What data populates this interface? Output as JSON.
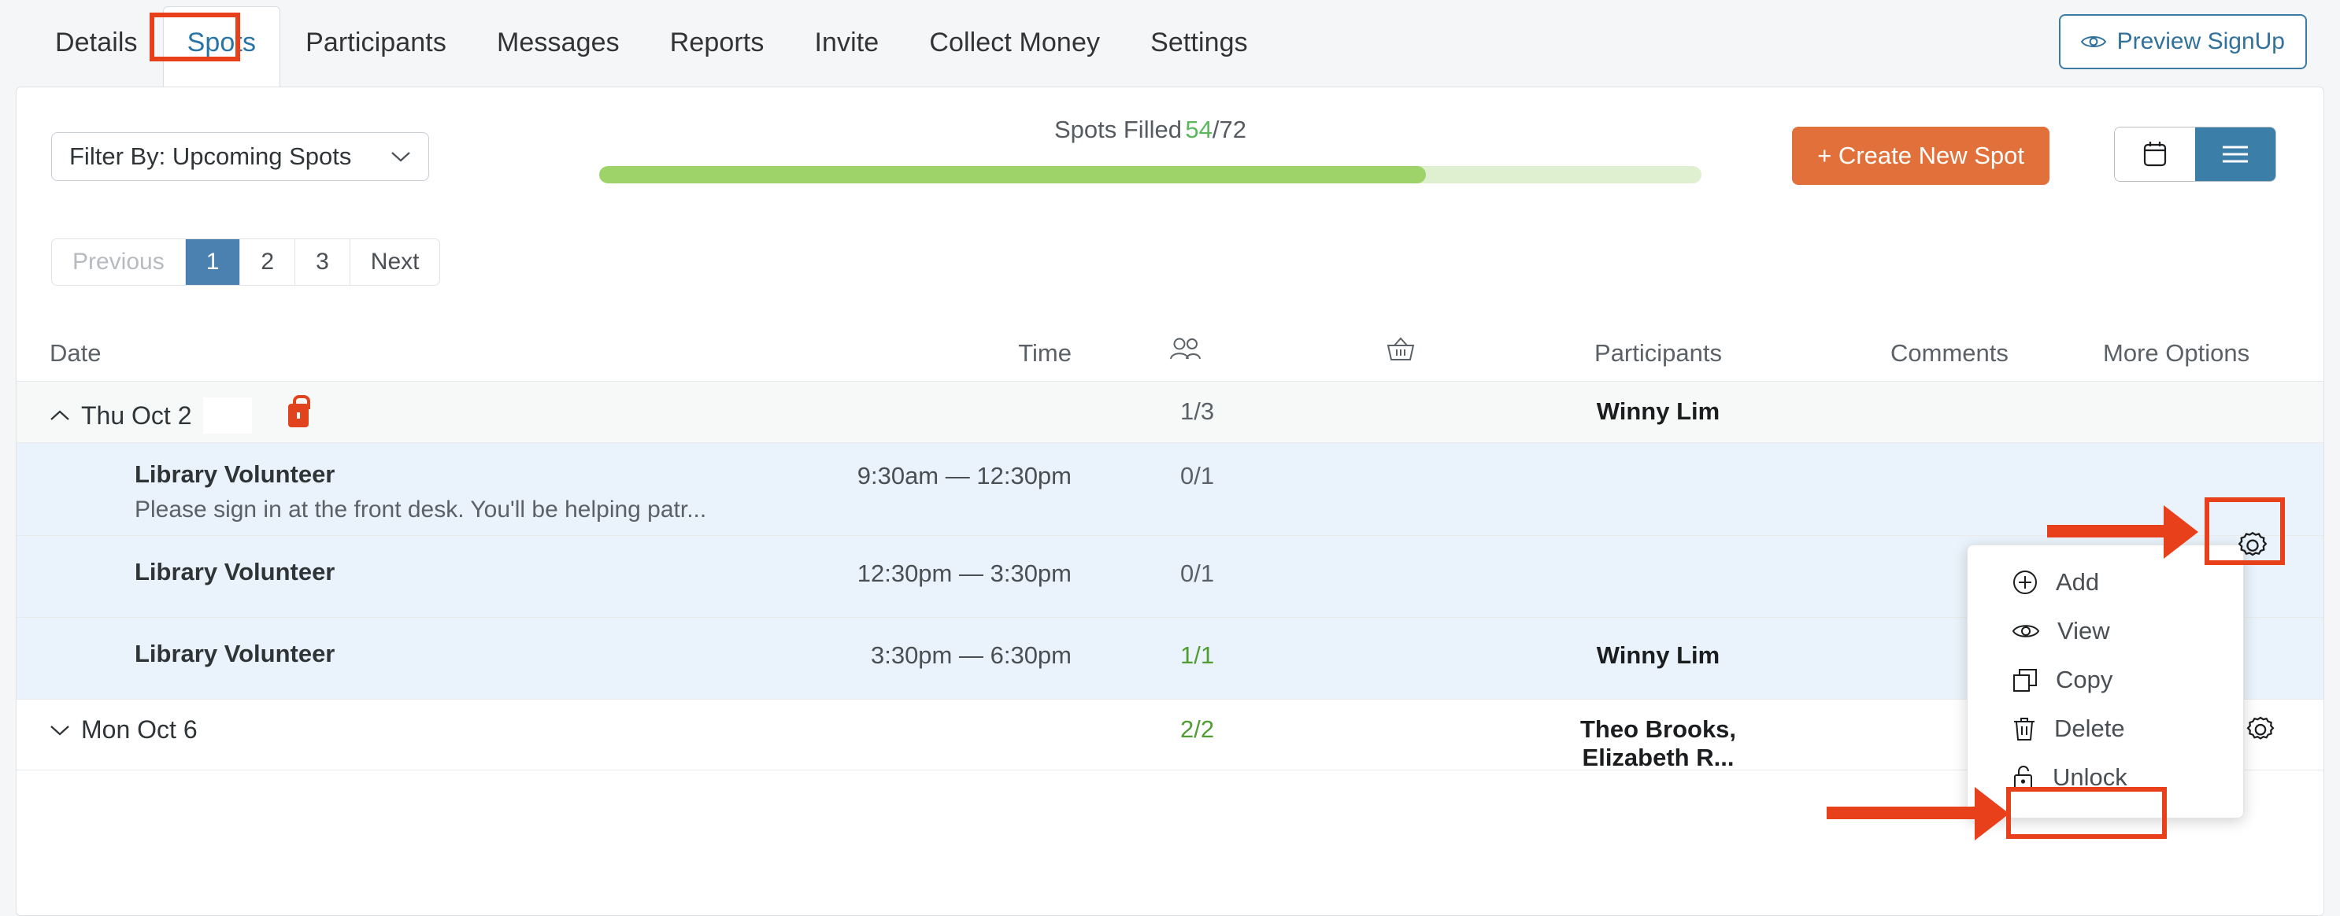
{
  "tabs": [
    {
      "label": "Details",
      "active": false
    },
    {
      "label": "Spots",
      "active": true
    },
    {
      "label": "Participants",
      "active": false
    },
    {
      "label": "Messages",
      "active": false
    },
    {
      "label": "Reports",
      "active": false
    },
    {
      "label": "Invite",
      "active": false
    },
    {
      "label": "Collect Money",
      "active": false
    },
    {
      "label": "Settings",
      "active": false
    }
  ],
  "header": {
    "preview_button": "Preview SignUp",
    "preview_icon": "eye-icon"
  },
  "toolbar": {
    "filter_label": "Filter By: Upcoming Spots",
    "filter_chevron": "chevron-down-icon",
    "spots_filled_label": "Spots Filled",
    "spots_filled_count": "54",
    "spots_filled_total": "/72",
    "progress_percent": 75,
    "create_button": "+ Create New Spot",
    "calendar_view_icon": "calendar-icon",
    "list_view_icon": "list-icon",
    "active_view": "list"
  },
  "pagination": {
    "previous": "Previous",
    "pages": [
      "1",
      "2",
      "3"
    ],
    "active_page": "1",
    "next": "Next"
  },
  "table": {
    "columns": {
      "date": "Date",
      "time": "Time",
      "capacity_icon": "people-icon",
      "item_icon": "basket-icon",
      "participants": "Participants",
      "comments": "Comments",
      "more_options": "More Options"
    },
    "rows": [
      {
        "type": "group",
        "date": "Thu Oct 2",
        "locked": true,
        "lock_icon": "lock-icon",
        "collapse_icon": "chevron-up-icon",
        "capacity": "1/3",
        "capacity_full": false,
        "participants": "Winny Lim",
        "gear_icon": "gear-icon"
      },
      {
        "type": "spot",
        "name": "Library Volunteer",
        "description": "Please sign in at the front desk. You'll be helping patr...",
        "time": "9:30am  —  12:30pm",
        "capacity": "0/1",
        "capacity_full": false,
        "participants": ""
      },
      {
        "type": "spot",
        "name": "Library Volunteer",
        "description": "",
        "time": "12:30pm  —  3:30pm",
        "capacity": "0/1",
        "capacity_full": false,
        "participants": ""
      },
      {
        "type": "spot",
        "name": "Library Volunteer",
        "description": "",
        "time": "3:30pm  —  6:30pm",
        "capacity": "1/1",
        "capacity_full": true,
        "participants": "Winny Lim"
      },
      {
        "type": "group",
        "date": "Mon Oct 6",
        "locked": false,
        "collapse_icon": "chevron-down-icon",
        "capacity": "2/2",
        "capacity_full": true,
        "participants": "Theo Brooks, Elizabeth R...",
        "gear_icon": "gear-icon"
      }
    ]
  },
  "context_menu": {
    "items": [
      {
        "label": "Add",
        "icon": "plus-circle-icon"
      },
      {
        "label": "View",
        "icon": "eye-icon"
      },
      {
        "label": "Copy",
        "icon": "copy-icon"
      },
      {
        "label": "Delete",
        "icon": "trash-icon"
      },
      {
        "label": "Unlock",
        "icon": "unlock-icon"
      }
    ],
    "highlighted_item": "Unlock"
  },
  "annotations": {
    "color": "#e8401a",
    "targets": [
      "Spots tab",
      "More Options gear icon",
      "Unlock menu item"
    ]
  },
  "colors": {
    "accent_orange": "#e2703a",
    "accent_blue": "#3b7ea8",
    "progress_green": "#9ed36a",
    "annotation_red": "#e8401a",
    "row_highlight": "#eaf3fb"
  }
}
